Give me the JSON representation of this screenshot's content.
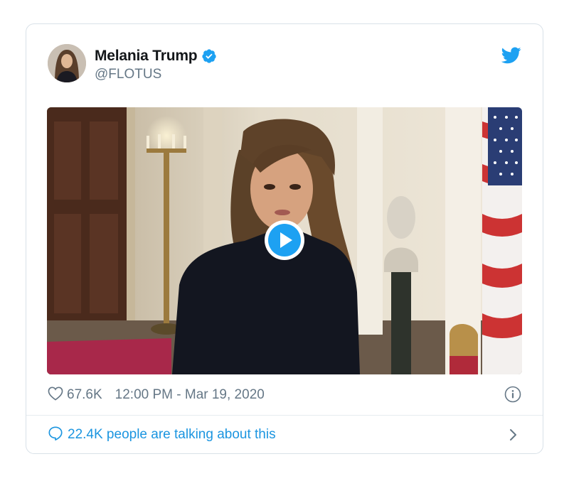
{
  "tweet": {
    "author": {
      "display_name": "Melania Trump",
      "handle": "@FLOTUS",
      "verified": true
    },
    "icons": {
      "verified": "verified-badge-icon",
      "twitter": "twitter-bird-icon",
      "like": "heart-icon",
      "info": "info-icon",
      "reply": "speech-bubble-icon",
      "more": "chevron-right-icon",
      "play": "play-icon"
    },
    "media": {
      "type": "video",
      "playable": true
    },
    "likes": "67.6K",
    "timestamp": "12:00 PM - Mar 19, 2020",
    "conversation": "22.4K people are talking about this"
  },
  "colors": {
    "brand_blue": "#1da1f2",
    "link_blue": "#1b95e0",
    "text_primary": "#14171a",
    "text_secondary": "#657786",
    "border": "#d9e1e8"
  }
}
